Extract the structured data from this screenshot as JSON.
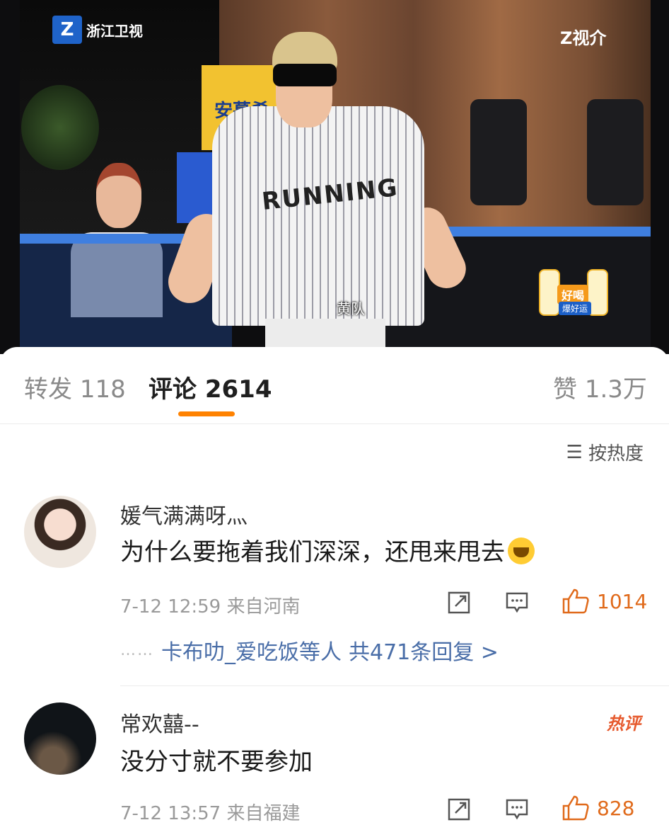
{
  "video": {
    "channel_logo": "浙江卫视",
    "corner_logo": "Z视介",
    "subtitle": "黄队",
    "sign_text": "安慕希",
    "jersey_text": "RUNNING",
    "ad_badge": "好喝",
    "ad_sub": "爆好运"
  },
  "tabs": [
    {
      "label": "转发",
      "count": "118"
    },
    {
      "label": "评论",
      "count": "2614"
    },
    {
      "label": "赞",
      "count": "1.3万"
    }
  ],
  "sort": {
    "label": "按热度",
    "icon": "sort-icon"
  },
  "comments": [
    {
      "username": "媛气满满呀灬",
      "text": "为什么要拖着我们深深，还甩来甩去",
      "emoji": "crying-face",
      "time": "7-12 12:59",
      "location": "来自河南",
      "likes": "1014",
      "replies_prefix": "卡布叻_爱吃饭等人",
      "replies_summary": "共471条回复 >"
    },
    {
      "username": "常欢囍--",
      "text": "没分寸就不要参加",
      "badge": "热评",
      "time": "7-12 13:57",
      "location": "来自福建",
      "likes": "828"
    }
  ],
  "colors": {
    "accent": "#ff8200",
    "link": "#4a6ea8",
    "like": "#e06a1b"
  }
}
